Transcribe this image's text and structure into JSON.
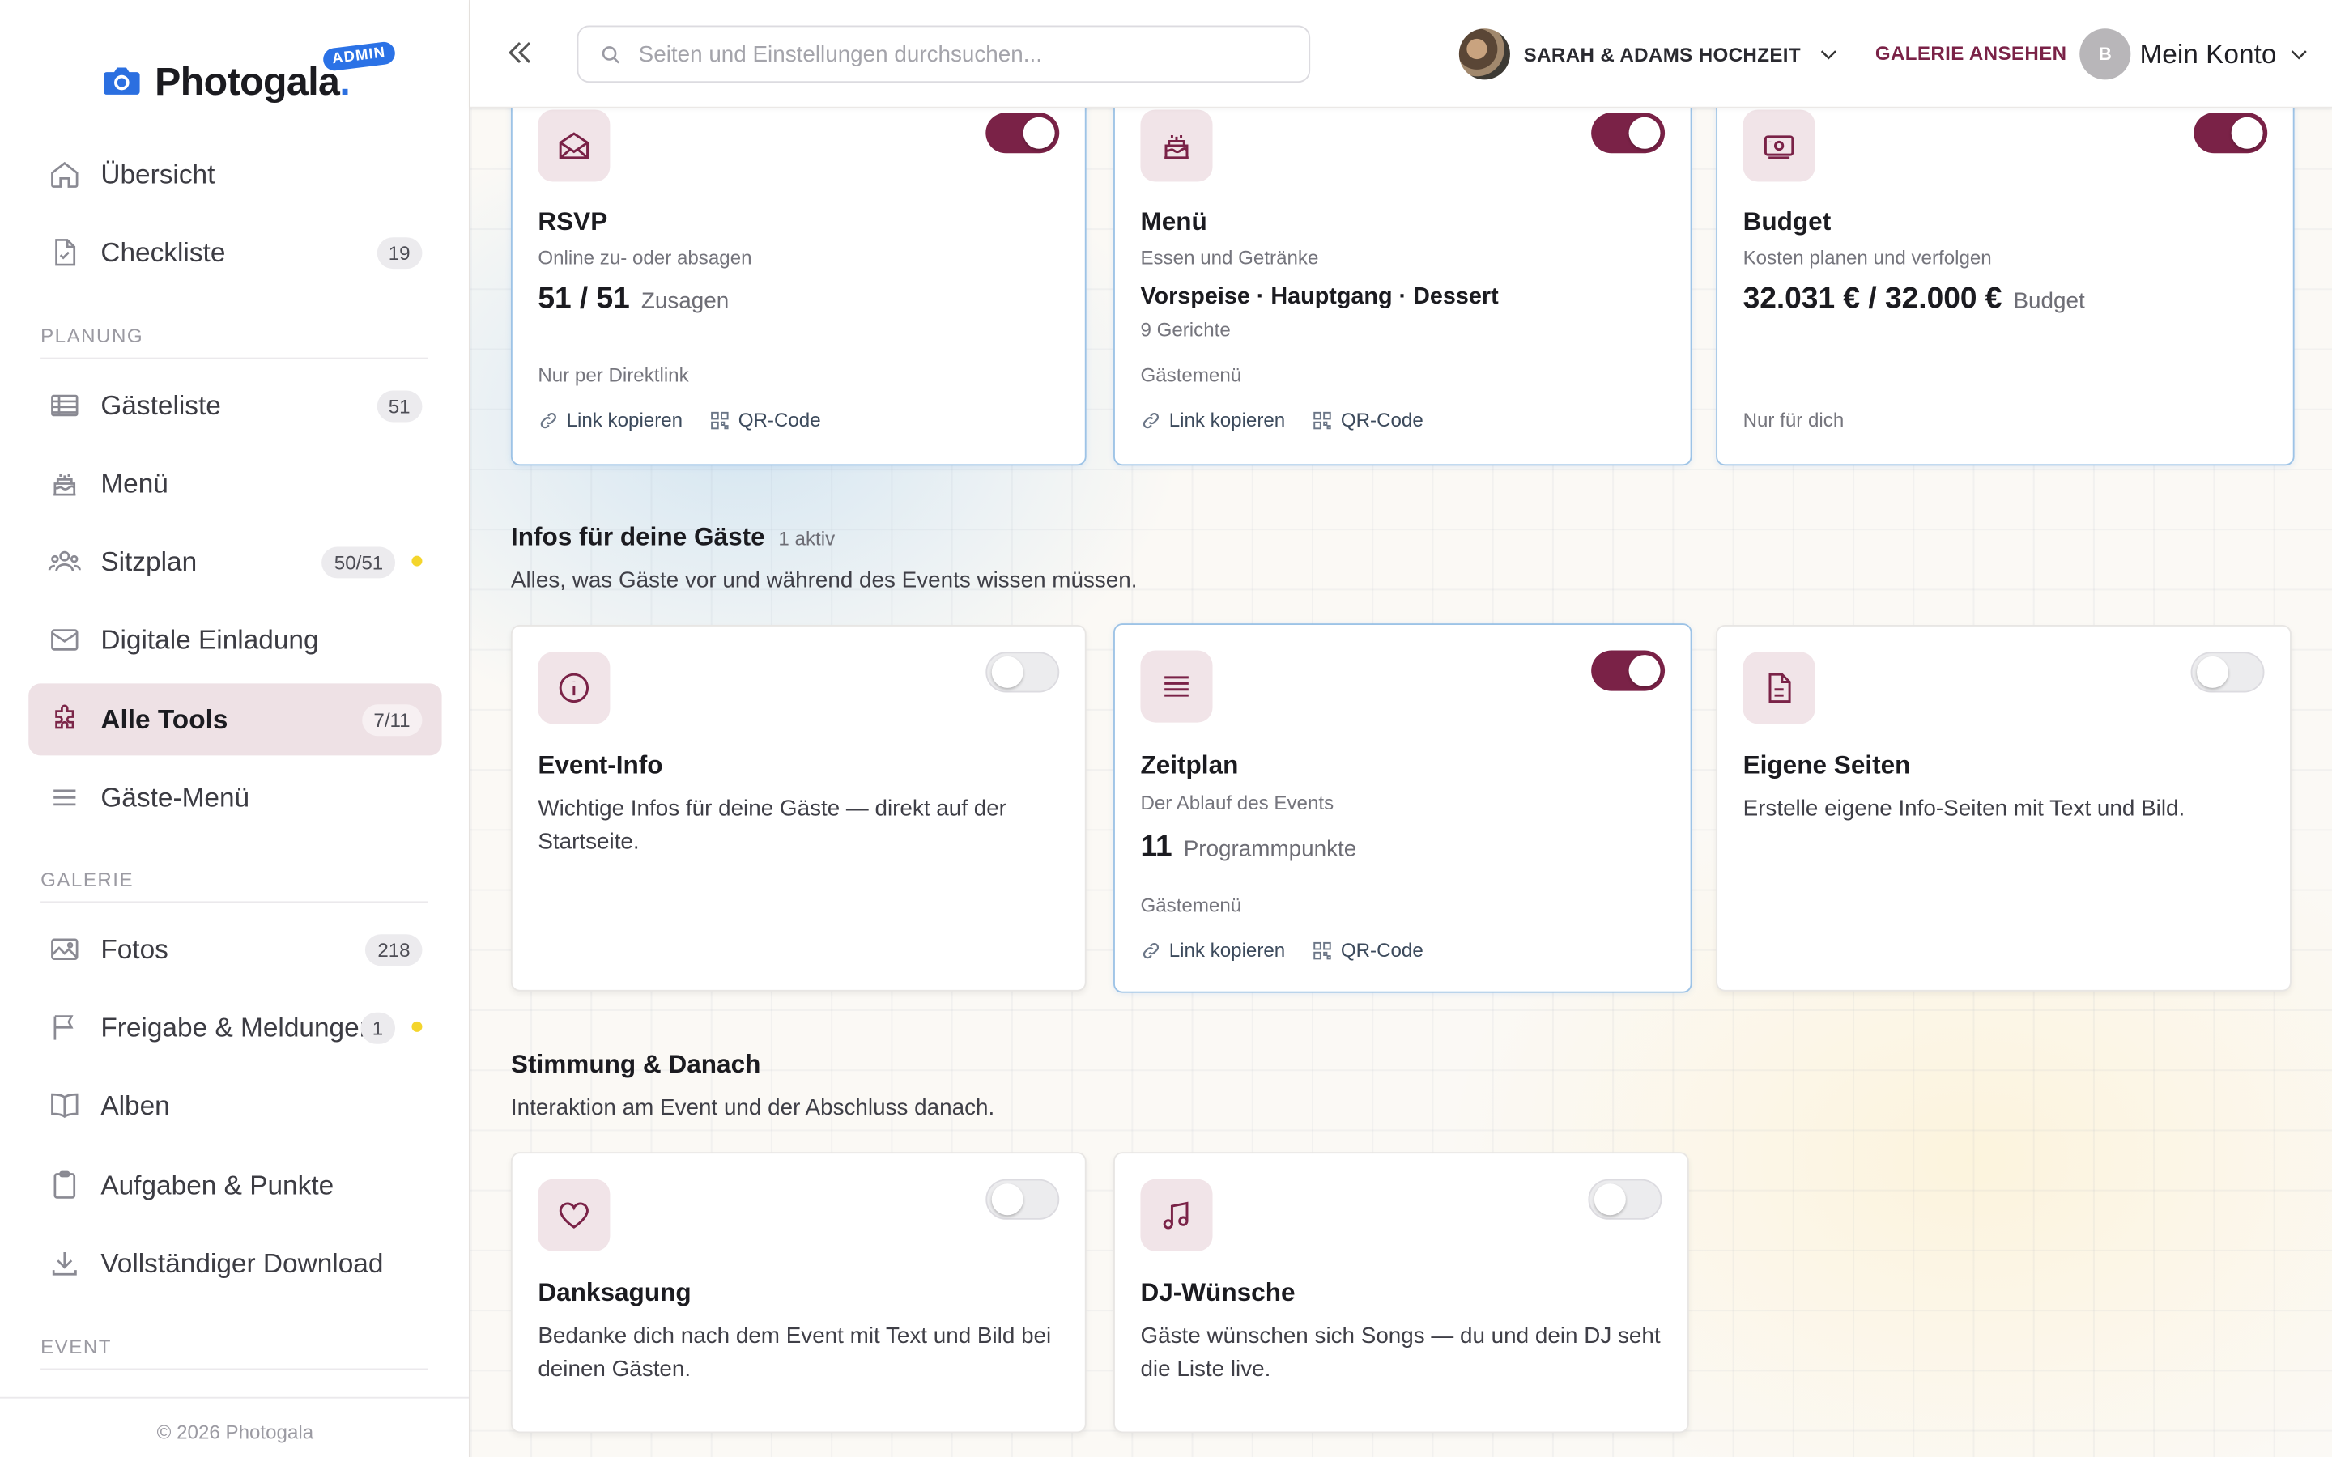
{
  "brand": {
    "name": "Photogala",
    "dot": ".",
    "badge": "ADMIN",
    "accent": "#7a2247",
    "blue": "#2b72e6"
  },
  "sidebar": {
    "items": [
      {
        "label": "Übersicht",
        "icon": "home-icon"
      },
      {
        "label": "Checkliste",
        "icon": "document-check-icon",
        "badge": "19"
      },
      {
        "label": "Gästeliste",
        "icon": "table-list-icon",
        "badge": "51"
      },
      {
        "label": "Menü",
        "icon": "cake-icon"
      },
      {
        "label": "Sitzplan",
        "icon": "users-icon",
        "badge": "50/51",
        "dot": true
      },
      {
        "label": "Digitale Einladung",
        "icon": "envelope-icon"
      },
      {
        "label": "Alle Tools",
        "icon": "puzzle-icon",
        "badge": "7/11",
        "active": true
      },
      {
        "label": "Gäste-Menü",
        "icon": "hamburger-menu-icon"
      },
      {
        "label": "Fotos",
        "icon": "image-icon",
        "badge": "218"
      },
      {
        "label": "Freigabe & Meldungen",
        "icon": "flag-icon",
        "badge": "1",
        "dot": true
      },
      {
        "label": "Alben",
        "icon": "book-icon"
      },
      {
        "label": "Aufgaben & Punkte",
        "icon": "clipboard-icon"
      },
      {
        "label": "Vollständiger Download",
        "icon": "download-icon"
      }
    ],
    "sections": {
      "planung": "PLANUNG",
      "galerie": "GALERIE",
      "event": "EVENT"
    },
    "copyright": "© 2026 Photogala"
  },
  "header": {
    "search_placeholder": "Seiten und Einstellungen durchsuchen...",
    "event_name": "SARAH & ADAMS HOCHZEIT",
    "gallery_link": "GALERIE ANSEHEN",
    "account_initial": "B",
    "account_label": "Mein Konto"
  },
  "cards_top": [
    {
      "title": "RSVP",
      "sub": "Online zu- oder absagen",
      "stat": "51 / 51",
      "stat_unit": "Zusagen",
      "meta": "Nur per Direktlink",
      "link": "Link kopieren",
      "qr": "QR-Code",
      "enabled": true,
      "icon": "envelope-open-icon"
    },
    {
      "title": "Menü",
      "sub": "Essen und Getränke",
      "stat2": "Vorspeise · Hauptgang · Dessert",
      "stat2_sub": "9 Gerichte",
      "meta": "Gästemenü",
      "link": "Link kopieren",
      "qr": "QR-Code",
      "enabled": true,
      "icon": "cake-icon"
    },
    {
      "title": "Budget",
      "sub": "Kosten planen und verfolgen",
      "stat": "32.031 € / 32.000 €",
      "stat_unit": "Budget",
      "meta": "Nur für dich",
      "enabled": true,
      "icon": "money-icon"
    }
  ],
  "section_infos": {
    "title": "Infos für deine Gäste",
    "count": "1 aktiv",
    "desc": "Alles, was Gäste vor und während des Events wissen müssen."
  },
  "cards_infos": [
    {
      "title": "Event-Info",
      "desc": "Wichtige Infos für deine Gäste — direkt auf der Startseite.",
      "enabled": false,
      "icon": "info-icon"
    },
    {
      "title": "Zeitplan",
      "sub": "Der Ablauf des Events",
      "stat": "11",
      "stat_unit": "Programmpunkte",
      "meta": "Gästemenü",
      "link": "Link kopieren",
      "qr": "QR-Code",
      "enabled": true,
      "icon": "list-icon"
    },
    {
      "title": "Eigene Seiten",
      "desc": "Erstelle eigene Info-Seiten mit Text und Bild.",
      "enabled": false,
      "icon": "file-icon"
    }
  ],
  "section_mood": {
    "title": "Stimmung & Danach",
    "desc": "Interaktion am Event und der Abschluss danach."
  },
  "cards_mood": [
    {
      "title": "Danksagung",
      "desc": "Bedanke dich nach dem Event mit Text und Bild bei deinen Gästen.",
      "enabled": false,
      "icon": "heart-icon"
    },
    {
      "title": "DJ-Wünsche",
      "desc": "Gäste wünschen sich Songs — du und dein DJ seht die Liste live.",
      "enabled": false,
      "icon": "music-note-icon"
    }
  ]
}
